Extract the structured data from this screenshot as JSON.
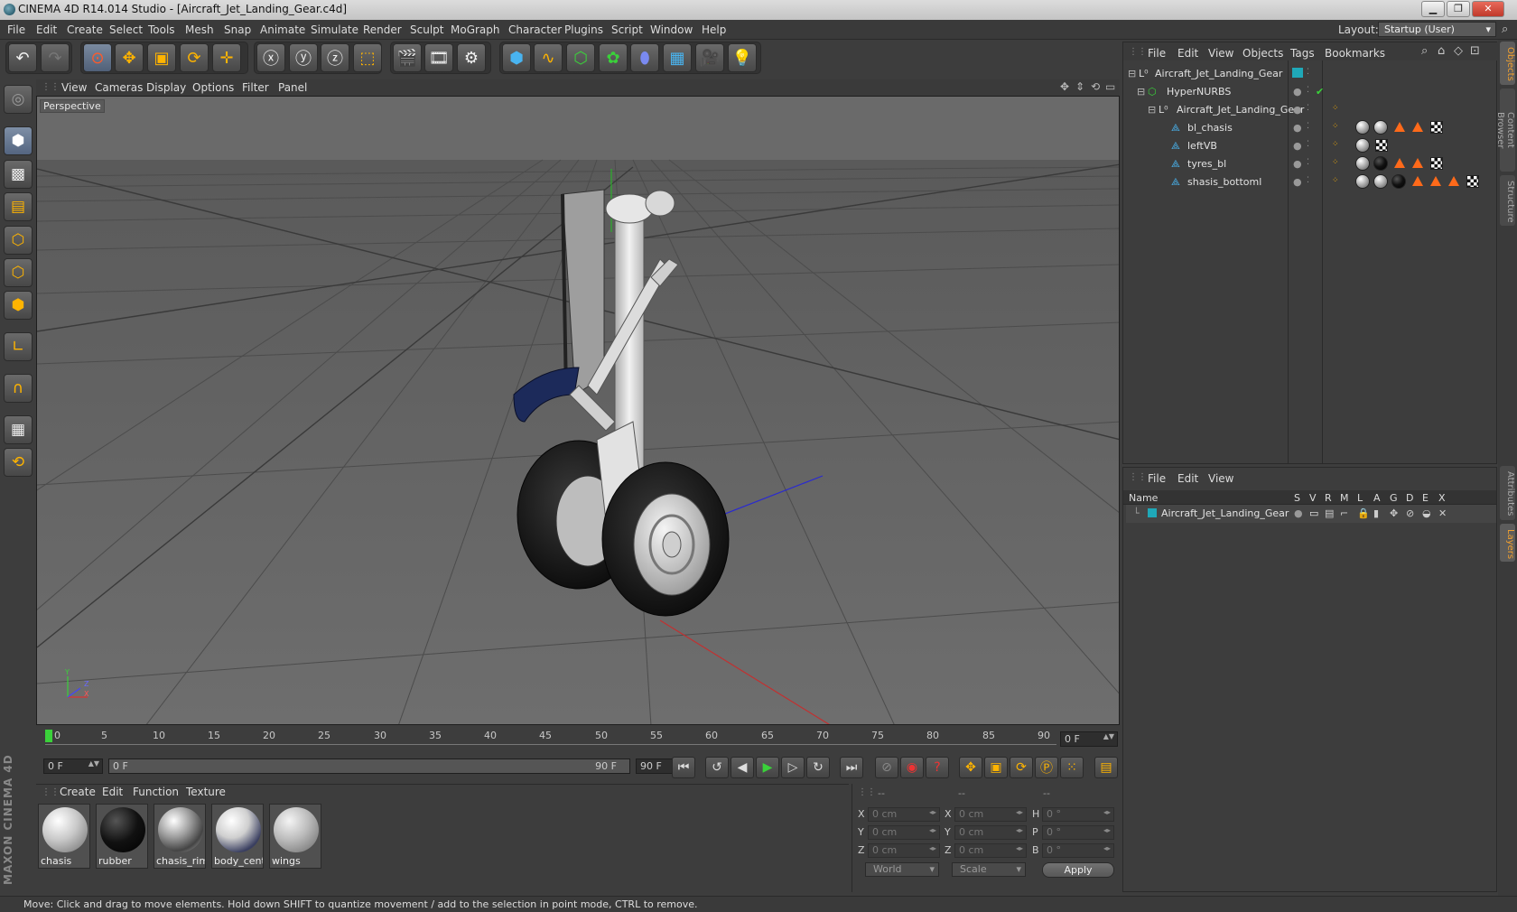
{
  "window": {
    "title": "CINEMA 4D R14.014 Studio - [Aircraft_Jet_Landing_Gear.c4d]",
    "minimize": "▁",
    "restore": "❐",
    "close": "✕"
  },
  "menu": [
    "File",
    "Edit",
    "Create",
    "Select",
    "Tools",
    "Mesh",
    "Snap",
    "Animate",
    "Simulate",
    "Render",
    "Sculpt",
    "MoGraph",
    "Character",
    "Plugins",
    "Script",
    "Window",
    "Help"
  ],
  "layout": {
    "label": "Layout:",
    "value": "Startup (User)"
  },
  "viewport": {
    "menu": [
      "View",
      "Cameras",
      "Display",
      "Options",
      "Filter",
      "Panel"
    ],
    "label": "Perspective",
    "axis_labels": {
      "x": "X",
      "y": "Y",
      "z": "Z"
    }
  },
  "timeline": {
    "ticks": [
      "0",
      "5",
      "10",
      "15",
      "20",
      "25",
      "30",
      "35",
      "40",
      "45",
      "50",
      "55",
      "60",
      "65",
      "70",
      "75",
      "80",
      "85",
      "90"
    ],
    "current_frame": "0 F",
    "start": "0 F",
    "range_start": "0 F",
    "range_end": "90 F",
    "end": "90 F"
  },
  "materials": {
    "menu": [
      "Create",
      "Edit",
      "Function",
      "Texture"
    ],
    "items": [
      {
        "name": "chasis"
      },
      {
        "name": "rubber"
      },
      {
        "name": "chasis_rim"
      },
      {
        "name": "body_cente"
      },
      {
        "name": "wings"
      }
    ]
  },
  "coordinates": {
    "col_heads": [
      "--",
      "--",
      "--"
    ],
    "rows": [
      {
        "a": "X",
        "av": "0 cm",
        "b": "X",
        "bv": "0 cm",
        "c": "H",
        "cv": "0 °"
      },
      {
        "a": "Y",
        "av": "0 cm",
        "b": "Y",
        "bv": "0 cm",
        "c": "P",
        "cv": "0 °"
      },
      {
        "a": "Z",
        "av": "0 cm",
        "b": "Z",
        "bv": "0 cm",
        "c": "B",
        "cv": "0 °"
      }
    ],
    "mode": "World",
    "transform": "Scale",
    "apply": "Apply"
  },
  "objects": {
    "menu": [
      "File",
      "Edit",
      "View",
      "Objects",
      "Tags",
      "Bookmarks"
    ],
    "tree": [
      {
        "name": "Aircraft_Jet_Landing_Gear"
      },
      {
        "name": "HyperNURBS"
      },
      {
        "name": "Aircraft_Jet_Landing_Gear"
      },
      {
        "name": "bl_chasis"
      },
      {
        "name": "leftVB"
      },
      {
        "name": "tyres_bl"
      },
      {
        "name": "shasis_bottoml"
      }
    ]
  },
  "layers": {
    "menu": [
      "File",
      "Edit",
      "View"
    ],
    "columns": [
      "Name",
      "S",
      "V",
      "R",
      "M",
      "L",
      "A",
      "G",
      "D",
      "E",
      "X"
    ],
    "rows": [
      {
        "name": "Aircraft_Jet_Landing_Gear"
      }
    ]
  },
  "side_tabs": [
    "Objects",
    "Content Browser",
    "Structure",
    "Attributes",
    "Layers"
  ],
  "status": "Move: Click and drag to move elements. Hold down SHIFT to quantize movement / add to the selection in point mode, CTRL to remove.",
  "brand": {
    "logo_text": "MAXON CINEMA 4D"
  },
  "colors": {
    "accent": "#ffb400",
    "layer_color": "#1fa8b8",
    "status_green": "#3ad13a"
  }
}
